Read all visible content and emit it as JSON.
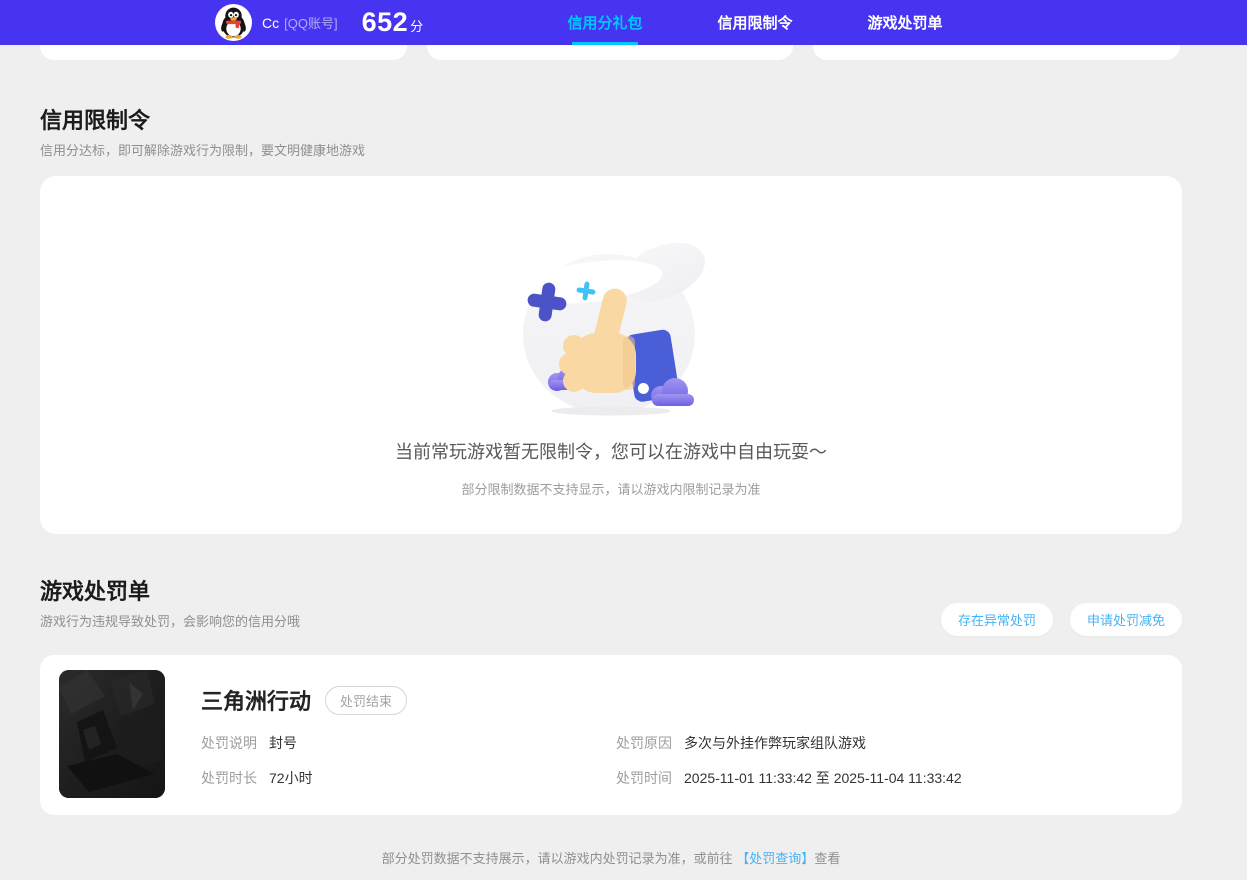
{
  "header": {
    "avatar_icon": "qq-penguin-icon",
    "user_name": "Cc",
    "account_label": "[QQ账号]",
    "score_value": "652",
    "score_unit": "分",
    "tabs": [
      {
        "label": "信用分礼包",
        "active": true
      },
      {
        "label": "信用限制令",
        "active": false
      },
      {
        "label": "游戏处罚单",
        "active": false
      }
    ]
  },
  "restriction_section": {
    "title": "信用限制令",
    "subtitle": "信用分达标，即可解除游戏行为限制，要文明健康地游戏",
    "empty_state": {
      "illustration": "thumbs-up-illustration",
      "message": "当前常玩游戏暂无限制令，您可以在游戏中自由玩耍～",
      "note": "部分限制数据不支持显示，请以游戏内限制记录为准"
    }
  },
  "penalty_section": {
    "title": "游戏处罚单",
    "subtitle": "游戏行为违规导致处罚，会影响您的信用分哦",
    "actions": [
      {
        "label": "存在异常处罚"
      },
      {
        "label": "申请处罚减免"
      }
    ],
    "record": {
      "game_title": "三角洲行动",
      "status_badge": "处罚结束",
      "fields": [
        {
          "label": "处罚说明",
          "value": "封号"
        },
        {
          "label": "处罚原因",
          "value": "多次与外挂作弊玩家组队游戏"
        },
        {
          "label": "处罚时长",
          "value": "72小时"
        },
        {
          "label": "处罚时间",
          "value": "2025-11-01 11:33:42 至 2025-11-04 11:33:42"
        }
      ]
    },
    "footer_note": {
      "prefix": "部分处罚数据不支持展示，请以游戏内处罚记录为准，或前往 ",
      "link": "【处罚查询】",
      "suffix": "查看"
    }
  },
  "colors": {
    "nav_background": "#4734f1",
    "active_tab": "#00c8ff",
    "page_background": "#efefef",
    "link_blue": "#45b3f4",
    "sleeve_blue": "#4a5ed8",
    "hand_skin": "#f9d8a3",
    "cloud_purple": "#7d6fe7"
  }
}
